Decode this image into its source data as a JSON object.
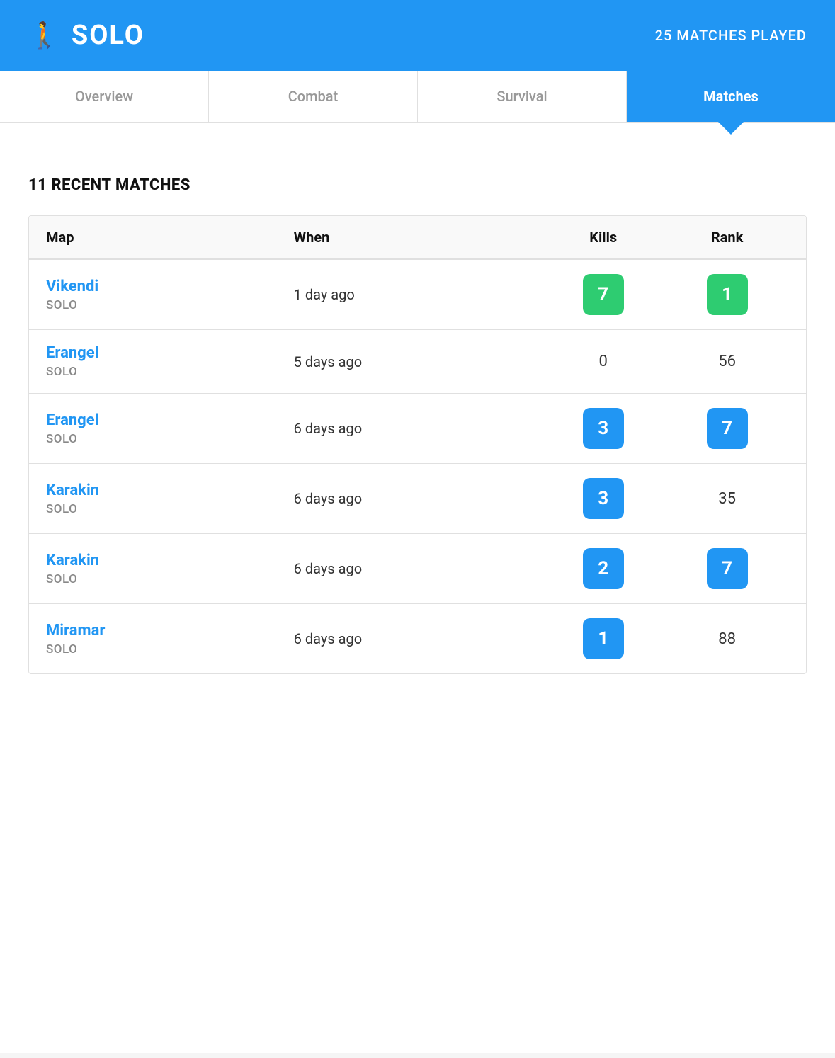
{
  "header": {
    "icon": "🚶",
    "title": "SOLO",
    "matches_played": "25 MATCHES PLAYED"
  },
  "tabs": [
    {
      "label": "Overview",
      "active": false
    },
    {
      "label": "Combat",
      "active": false
    },
    {
      "label": "Survival",
      "active": false
    },
    {
      "label": "Matches",
      "active": true
    }
  ],
  "section_title": "11 RECENT MATCHES",
  "table": {
    "headers": [
      "Map",
      "When",
      "Kills",
      "Rank"
    ],
    "rows": [
      {
        "map": "Vikendi",
        "mode": "SOLO",
        "when": "1 day ago",
        "kills": 7,
        "kills_badge": "green",
        "rank": 1,
        "rank_badge": "green"
      },
      {
        "map": "Erangel",
        "mode": "SOLO",
        "when": "5 days ago",
        "kills": 0,
        "kills_badge": null,
        "rank": 56,
        "rank_badge": null
      },
      {
        "map": "Erangel",
        "mode": "SOLO",
        "when": "6 days ago",
        "kills": 3,
        "kills_badge": "blue",
        "rank": 7,
        "rank_badge": "blue"
      },
      {
        "map": "Karakin",
        "mode": "SOLO",
        "when": "6 days ago",
        "kills": 3,
        "kills_badge": "blue",
        "rank": 35,
        "rank_badge": null
      },
      {
        "map": "Karakin",
        "mode": "SOLO",
        "when": "6 days ago",
        "kills": 2,
        "kills_badge": "blue",
        "rank": 7,
        "rank_badge": "blue"
      },
      {
        "map": "Miramar",
        "mode": "SOLO",
        "when": "6 days ago",
        "kills": 1,
        "kills_badge": "blue",
        "rank": 88,
        "rank_badge": null
      }
    ]
  },
  "colors": {
    "primary": "#2196F3",
    "green": "#2ecc71",
    "header_bg": "#2196F3"
  }
}
